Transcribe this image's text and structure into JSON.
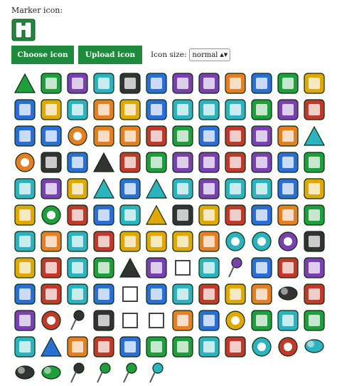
{
  "marker": {
    "label": "Marker icon:",
    "selected_icon": "binoculars-icon"
  },
  "toolbar": {
    "choose_label": "Choose icon",
    "upload_label": "Upload icon",
    "size_label": "Icon size:",
    "size_value": "normal",
    "accent_color": "#1e8a3c"
  },
  "icons": [
    "mountain",
    "factory",
    "cow",
    "beach-hut",
    "torii-gate",
    "police-badge",
    "gondola",
    "skiing",
    "first-aid-cross",
    "ski-lift",
    "outdoor-shower",
    "wheelchair-ramp",
    "ferry",
    "tower",
    "museum",
    "monument",
    "accessible",
    "bus-dock",
    "lighthouse",
    "telephone",
    "swimming",
    "spa",
    "parking",
    "toys",
    "hotel-bed",
    "climbing",
    "help-question",
    "fire-hydrant",
    "gas-station",
    "toilet",
    "binoculars",
    "restaurant",
    "shrine-gate",
    "shop",
    "apple",
    "camp-tent",
    "crop-circle",
    "cable-car",
    "bus",
    "pyramid",
    "water-tower",
    "airport",
    "arrow-curve",
    "arrow-down",
    "theater",
    "cocktail",
    "close-small",
    "bus-front",
    "taxi",
    "photo-camera",
    "campfire",
    "tent-camp",
    "flowers-small",
    "warning",
    "church",
    "coffee",
    "bottle-apple",
    "grid-window",
    "cycling",
    "cutlery",
    "dollar",
    "ring-circle",
    "scrap",
    "television",
    "euro",
    "mountain-climbing",
    "boat",
    "volcano",
    "fishing",
    "flag",
    "forbidden",
    "fuel-pump",
    "golf",
    "basket",
    "helicopter",
    "car-wash",
    "hiking",
    "house",
    "horse-riding",
    "hospital",
    "info",
    "info-circle",
    "help-circle",
    "bed",
    "person",
    "anchor",
    "wrench",
    "motorbike",
    "triangle-green",
    "movie-camera",
    "diamond",
    "parking-p",
    "pine-tree",
    "prescription",
    "telephone-red",
    "picnic",
    "bus-stops",
    "golf-drive",
    "arrow-diag",
    "police-officer",
    "hexagon",
    "mail",
    "subway",
    "farm",
    "sign-board",
    "highway-shield",
    "cloud-shapes",
    "sailboat",
    "flag-hill",
    "sphere",
    "shopping",
    "oil-can",
    "square",
    "star-outline",
    "subway-tunnel",
    "swimming-waves",
    "target",
    "photo-group",
    "family",
    "map-frame",
    "tram",
    "triangle-outline",
    "truck",
    "volcano-eruption",
    "waves",
    "ufo",
    "wheelchair",
    "woman",
    "yen",
    "sun",
    "cloud-sun",
    "snowflake",
    "rain-cloud",
    "storm-cloud",
    "pin-blue",
    "pin-green",
    "pin-teal",
    "pin-magenta"
  ]
}
